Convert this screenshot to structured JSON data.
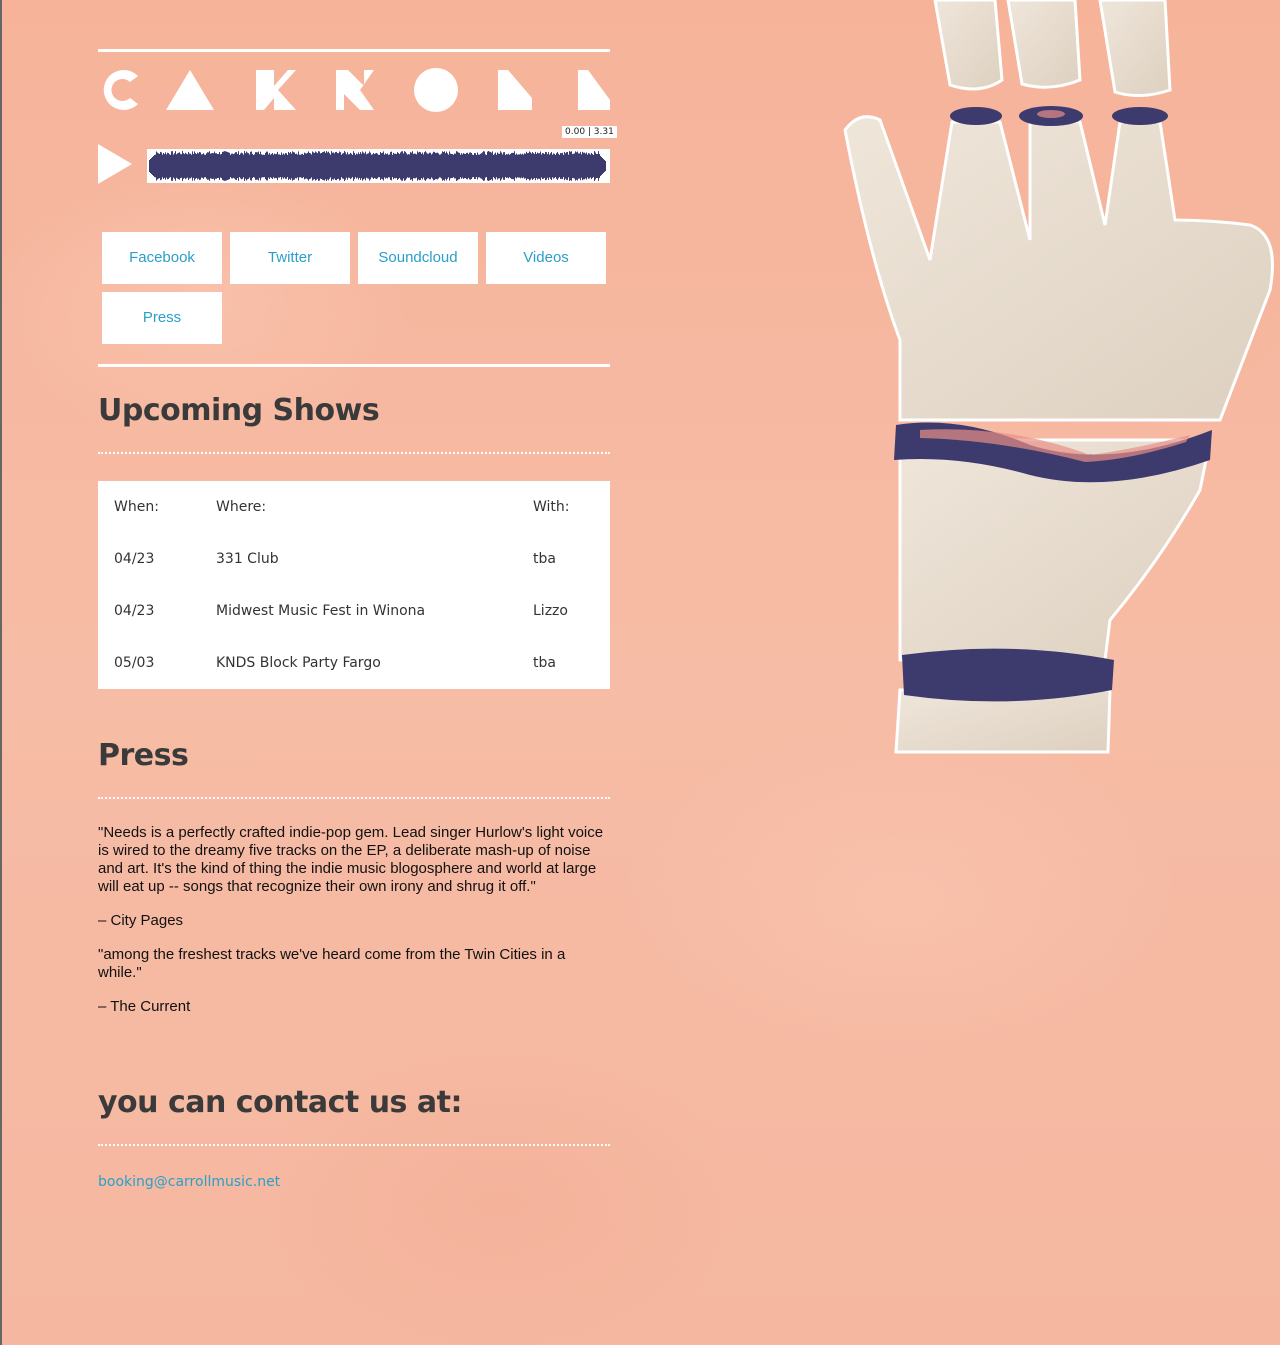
{
  "logo": {
    "text": "CARROLL"
  },
  "player": {
    "time": "0.00 | 3.31",
    "waveform_color": "#3d3a6e",
    "play_icon": "play-icon"
  },
  "nav": {
    "items": [
      {
        "label": "Facebook"
      },
      {
        "label": "Twitter"
      },
      {
        "label": "Soundcloud"
      },
      {
        "label": "Videos"
      },
      {
        "label": "Press"
      }
    ],
    "link_color": "#2b9fc9"
  },
  "shows": {
    "heading": "Upcoming Shows",
    "columns": [
      "When:",
      "Where:",
      "With:"
    ],
    "rows": [
      {
        "when": "04/23",
        "where": "331 Club",
        "with": "tba"
      },
      {
        "when": "04/23",
        "where": "Midwest Music Fest in Winona",
        "with": "Lizzo"
      },
      {
        "when": "05/03",
        "where": "KNDS Block Party Fargo",
        "with": "tba"
      }
    ]
  },
  "press": {
    "heading": "Press",
    "quotes": [
      {
        "text": "\"Needs is a perfectly crafted indie-pop gem. Lead singer Hurlow's light voice is wired to the dreamy five tracks on the EP, a deliberate mash-up of noise and art. It's the kind of thing the indie music blogosphere and world at large will eat up -- songs that recognize their own irony and shrug it off.\"",
        "source": "– City Pages"
      },
      {
        "text": "\"among the freshest tracks we've heard come from the Twin Cities in a while.\"",
        "source": "– The Current"
      }
    ]
  },
  "contact": {
    "heading": "you can contact us at:",
    "email": "booking@carrollmusic.net"
  },
  "colors": {
    "background": "#f5b49c",
    "heading": "#3a3a3a",
    "band_blue": "#3d3a6e"
  }
}
